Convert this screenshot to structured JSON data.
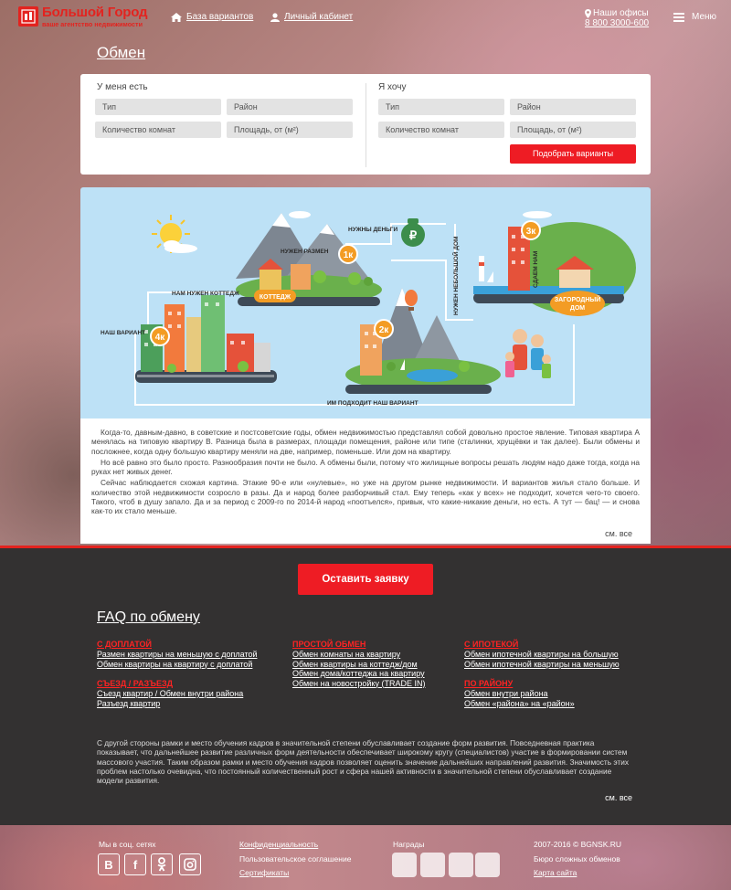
{
  "header": {
    "logo_name": "Большой Город",
    "logo_tagline": "ваше агентство недвижимости",
    "nav": [
      {
        "label": "База вариантов",
        "icon": "home-icon"
      },
      {
        "label": "Личный кабинет",
        "icon": "user-icon"
      }
    ],
    "offices_label": "Наши офисы",
    "offices_icon": "map-pin-icon",
    "phone": "8 800 3000-600",
    "menu_label": "Меню"
  },
  "page_title": "Обмен",
  "search": {
    "have_title": "У меня есть",
    "want_title": "Я хочу",
    "have_fields": {
      "type": "Тип",
      "district": "Район",
      "rooms": "Количество комнат",
      "area": "Площадь, от (м²)"
    },
    "want_fields": {
      "type": "Тип",
      "district": "Район",
      "rooms": "Количество комнат",
      "area": "Площадь, от (м²)"
    },
    "submit_label": "Подобрать варианты"
  },
  "illustration": {
    "labels": {
      "our_variant": "НАШ ВАРИАНТ",
      "need_cottage": "НАМ НУЖЕН КОТТЕДЖ",
      "need_size": "НУЖЕН РАЗМЕН",
      "need_money": "НУЖНЫ ДЕНЬГИ",
      "need_small_house": "НУЖЕН НЕБОЛЬШОЙ ДОМ",
      "sdan_nam": "СДАЕМ НАМ",
      "fits_us": "ИМ ПОДХОДИТ НАШ ВАРИАНТ",
      "cottage": "КОТТЕДЖ",
      "country_house_1": "ЗАГОРОДНЫЙ",
      "country_house_2": "ДОМ"
    },
    "badges": {
      "b4": "4к",
      "b1": "1к",
      "b2": "2к",
      "b3": "3к"
    },
    "money_symbol": "₽"
  },
  "article": {
    "paragraphs": [
      "Когда-то, давным-давно, в советские и постсоветские годы, обмен недвижимостью представлял собой довольно простое явление. Типовая квартира А менялась на типовую квартиру В. Разница была в размерах, площади помещения, районе или типе (сталинки, хрущёвки и так далее). Были обмены и посложнее, когда одну большую квартиру меняли на две, например, поменьше. Или дом на квартиру.",
      "Но всё равно это было просто. Разнообразия почти не было. А обмены были, потому что жилищные вопросы решать людям надо даже тогда, когда на руках нет живых денег.",
      "Сейчас наблюдается схожая картина. Этакие 90-е или «нулевые», но уже на другом рынке недвижимости. И вариантов жилья стало больше. И количество этой недвижимости созросло в разы. Да и народ более разборчивый стал. Ему теперь «как у всех» не подходит, хочется чего-то своего. Такого, чтоб в душу запало. Да и за период с 2009-го по 2014-й народ «поотъелся», привык, что какие-никакие деньги, но есть. А тут — бац! — и снова как-то их стало меньше."
    ],
    "see_all": "см. все"
  },
  "cta": {
    "request_label": "Оставить заявку"
  },
  "faq": {
    "title": "FAQ по обмену",
    "groups": [
      {
        "head": "С ДОПЛАТОЙ",
        "links": [
          "Размен квартиры на меньшую с доплатой",
          "Обмен квартиры на квартиру с доплатой"
        ]
      },
      {
        "head": "СЪЕЗД / РАЗЪЕЗД",
        "links": [
          "Съезд квартир / Обмен внутри района",
          "Разъезд квартир"
        ]
      },
      {
        "head": "ПРОСТОЙ ОБМЕН",
        "links": [
          "Обмен комнаты на квартиру",
          "Обмен квартиры на коттедж/дом",
          "Обмен дома/коттеджа на квартиру",
          "Обмен на новостройку (TRADE IN)"
        ]
      },
      {
        "head": "С ИПОТЕКОЙ",
        "links": [
          "Обмен ипотечной квартиры на большую",
          "Обмен ипотечной квартиры на меньшую"
        ]
      },
      {
        "head": "ПО РАЙОНУ",
        "links": [
          "Обмен внутри района",
          "Обмен «района» на «район»"
        ]
      }
    ],
    "description": "С другой стороны рамки и место обучения кадров в значительной степени обуславливает создание форм развития. Повседневная практика показывает, что дальнейшее развитие различных форм деятельности обеспечивает широкому кругу (специалистов) участие в формировании систем массового участия. Таким образом рамки и место обучения кадров позволяет оценить значение дальнейших направлений развития. Значимость этих проблем настолько очевидна, что постоянный количественный рост и сфера нашей активности в значительной степени обуславливает создание модели развития.",
    "see_all": "см. все"
  },
  "footer": {
    "social_title": "Мы в соц. сетях",
    "social": [
      {
        "label": "В",
        "icon": "vk-icon"
      },
      {
        "label": "f",
        "icon": "facebook-icon"
      },
      {
        "label": "ok",
        "icon": "odnoklassniki-icon"
      },
      {
        "label": "ig",
        "icon": "instagram-icon"
      }
    ],
    "links": [
      "Конфиденциальность",
      "Пользовательское соглашение",
      "Сертификаты"
    ],
    "awards_title": "Награды",
    "copyright": "2007-2016 © BGNSK.RU",
    "bureau": "Бюро сложных обменов",
    "sitemap": "Карта сайта"
  }
}
